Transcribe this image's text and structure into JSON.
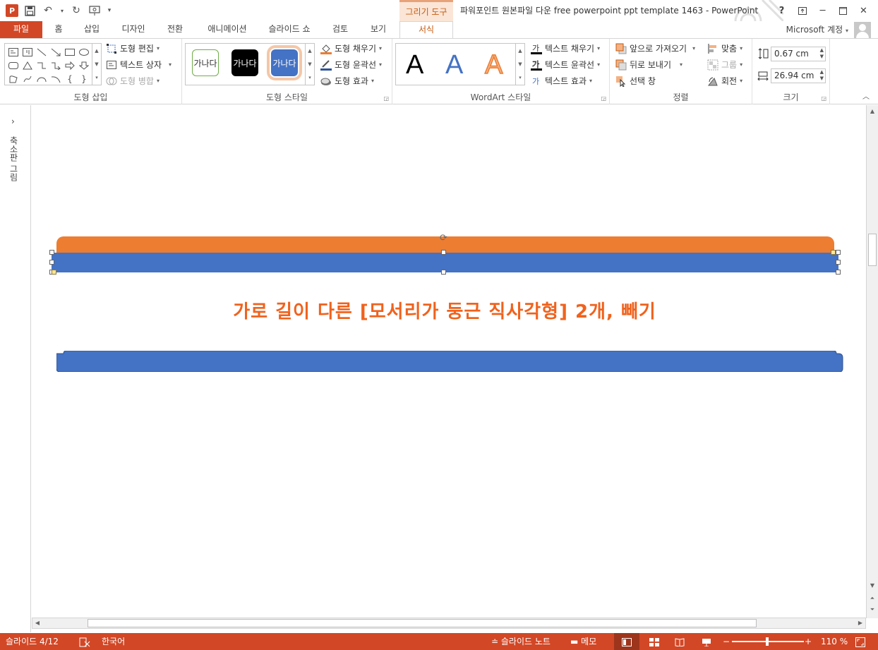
{
  "window": {
    "title": "파워포인트 원본파일 다운 free powerpoint ppt template 1463 - PowerPoint",
    "context_tab": "그리기 도구",
    "account": "Microsoft 계정"
  },
  "tabs": [
    {
      "label": "파일"
    },
    {
      "label": "홈"
    },
    {
      "label": "삽입"
    },
    {
      "label": "디자인"
    },
    {
      "label": "전환"
    },
    {
      "label": "애니메이션"
    },
    {
      "label": "슬라이드 쇼"
    },
    {
      "label": "검토"
    },
    {
      "label": "보기"
    },
    {
      "label": "서식"
    }
  ],
  "ribbon": {
    "insert_shapes": {
      "label": "도형 삽입",
      "edit_shape": "도형 편집",
      "text_box": "텍스트 상자",
      "merge_shapes": "도형 병합"
    },
    "shape_styles": {
      "label": "도형 스타일",
      "sample_text": "가나다",
      "fill": "도형 채우기",
      "outline": "도형 윤곽선",
      "effects": "도형 효과"
    },
    "wordart": {
      "label": "WordArt 스타일",
      "sample": "A",
      "text_fill": "텍스트 채우기",
      "text_outline": "텍스트 윤곽선",
      "text_effects": "텍스트 효과"
    },
    "arrange": {
      "label": "정렬",
      "bring_forward": "앞으로 가져오기",
      "send_backward": "뒤로 보내기",
      "selection_pane": "선택 창",
      "align": "맞춤",
      "group": "그룹",
      "rotate": "회전"
    },
    "size": {
      "label": "크기",
      "height": "0.67 cm",
      "width": "26.94 cm"
    }
  },
  "thumbnail_pane": {
    "label": "축소판 그림"
  },
  "slide": {
    "headline": "가로 길이 다른 [모서리가 둥근 직사각형] 2개, 빼기",
    "colors": {
      "orange": "#ed7d31",
      "blue": "#4472c4",
      "headline": "#f0621d"
    }
  },
  "statusbar": {
    "slide_indicator": "슬라이드 4/12",
    "language": "한국어",
    "notes": "슬라이드 노트",
    "comments": "메모",
    "zoom": "110 %"
  }
}
